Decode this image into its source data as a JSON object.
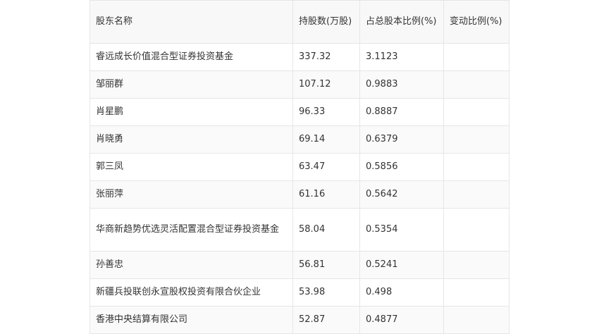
{
  "table": {
    "headers": [
      "股东名称",
      "持股数(万股)",
      "占总股本比例(%)",
      "变动比例(%)"
    ],
    "rows": [
      {
        "name": "睿远成长价值混合型证券投资基金",
        "shares": "337.32",
        "ratio": "3.1123",
        "change": ""
      },
      {
        "name": "邹丽群",
        "shares": "107.12",
        "ratio": "0.9883",
        "change": ""
      },
      {
        "name": "肖星鹏",
        "shares": "96.33",
        "ratio": "0.8887",
        "change": ""
      },
      {
        "name": "肖晓勇",
        "shares": "69.14",
        "ratio": "0.6379",
        "change": ""
      },
      {
        "name": "郭三凤",
        "shares": "63.47",
        "ratio": "0.5856",
        "change": ""
      },
      {
        "name": "张丽萍",
        "shares": "61.16",
        "ratio": "0.5642",
        "change": ""
      },
      {
        "name": "华商新趋势优选灵活配置混合型证券投资基金",
        "shares": "58.04",
        "ratio": "0.5354",
        "change": ""
      },
      {
        "name": "孙善忠",
        "shares": "56.81",
        "ratio": "0.5241",
        "change": ""
      },
      {
        "name": "新疆兵投联创永宣股权投资有限合伙企业",
        "shares": "53.98",
        "ratio": "0.498",
        "change": ""
      },
      {
        "name": "香港中央结算有限公司",
        "shares": "52.87",
        "ratio": "0.4877",
        "change": ""
      }
    ]
  }
}
